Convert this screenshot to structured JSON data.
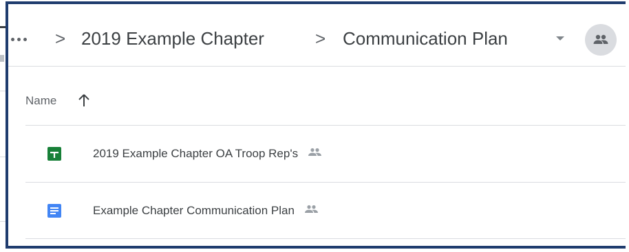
{
  "breadcrumb": {
    "overflow_label": "•••",
    "separator": ">",
    "items": [
      {
        "label": "2019 Example Chapter"
      },
      {
        "label": "Communication Plan"
      }
    ]
  },
  "list": {
    "column_name_label": "Name",
    "sort_direction": "ascending",
    "files": [
      {
        "name": "2019 Example Chapter OA Troop Rep's",
        "type": "google-sheets",
        "icon": "sheets-icon",
        "shared": true
      },
      {
        "name": "Example Chapter Communication Plan",
        "type": "google-docs",
        "icon": "docs-icon",
        "shared": true
      }
    ]
  },
  "colors": {
    "frame": "#1f3c6e",
    "sheets": "#188038",
    "docs": "#4285f4",
    "text": "#3c4043",
    "muted": "#5f6368",
    "divider": "#dadce0"
  }
}
